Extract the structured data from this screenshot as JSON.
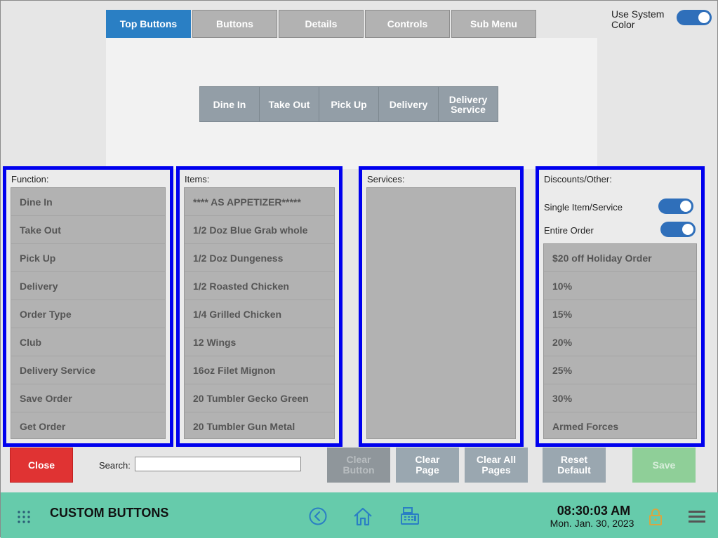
{
  "tabs": [
    {
      "label": "Top Buttons",
      "active": true
    },
    {
      "label": "Buttons",
      "active": false
    },
    {
      "label": "Details",
      "active": false
    },
    {
      "label": "Controls",
      "active": false
    },
    {
      "label": "Sub Menu",
      "active": false
    }
  ],
  "system_color": {
    "label": "Use System Color",
    "enabled": true
  },
  "preview_buttons": [
    "Dine In",
    "Take Out",
    "Pick Up",
    "Delivery",
    "Delivery Service"
  ],
  "function_panel": {
    "title": "Function:",
    "items": [
      "Dine In",
      "Take Out",
      "Pick Up",
      "Delivery",
      "Order Type",
      "Club",
      "Delivery Service",
      "Save Order",
      "Get Order"
    ]
  },
  "items_panel": {
    "title": "Items:",
    "items": [
      "**** AS APPETIZER*****",
      "1/2 Doz Blue Grab whole",
      "1/2 Doz Dungeness",
      "1/2 Roasted Chicken",
      "1/4 Grilled Chicken",
      "12 Wings",
      "16oz Filet Mignon",
      "20 Tumbler Gecko Green",
      "20 Tumbler Gun Metal"
    ]
  },
  "services_panel": {
    "title": "Services:",
    "items": []
  },
  "discounts_panel": {
    "title": "Discounts/Other:",
    "single_item_label": "Single Item/Service",
    "single_item_enabled": true,
    "entire_order_label": "Entire Order",
    "entire_order_enabled": true,
    "items": [
      "$20 off Holiday Order",
      "10%",
      "15%",
      "20%",
      "25%",
      "30%",
      "Armed Forces"
    ]
  },
  "actions": {
    "close": "Close",
    "search_label": "Search:",
    "search_value": "",
    "clear_button": "Clear Button",
    "clear_page": "Clear Page",
    "clear_all_pages": "Clear All Pages",
    "reset_default": "Reset Default",
    "save": "Save"
  },
  "footer": {
    "title": "CUSTOM BUTTONS",
    "time": "08:30:03 AM",
    "date": "Mon. Jan. 30, 2023"
  },
  "colors": {
    "accent": "#2a7fc4",
    "panel_border": "#0000ee",
    "footer": "#66cbab",
    "close": "#e03333",
    "save": "#8fcf98"
  }
}
